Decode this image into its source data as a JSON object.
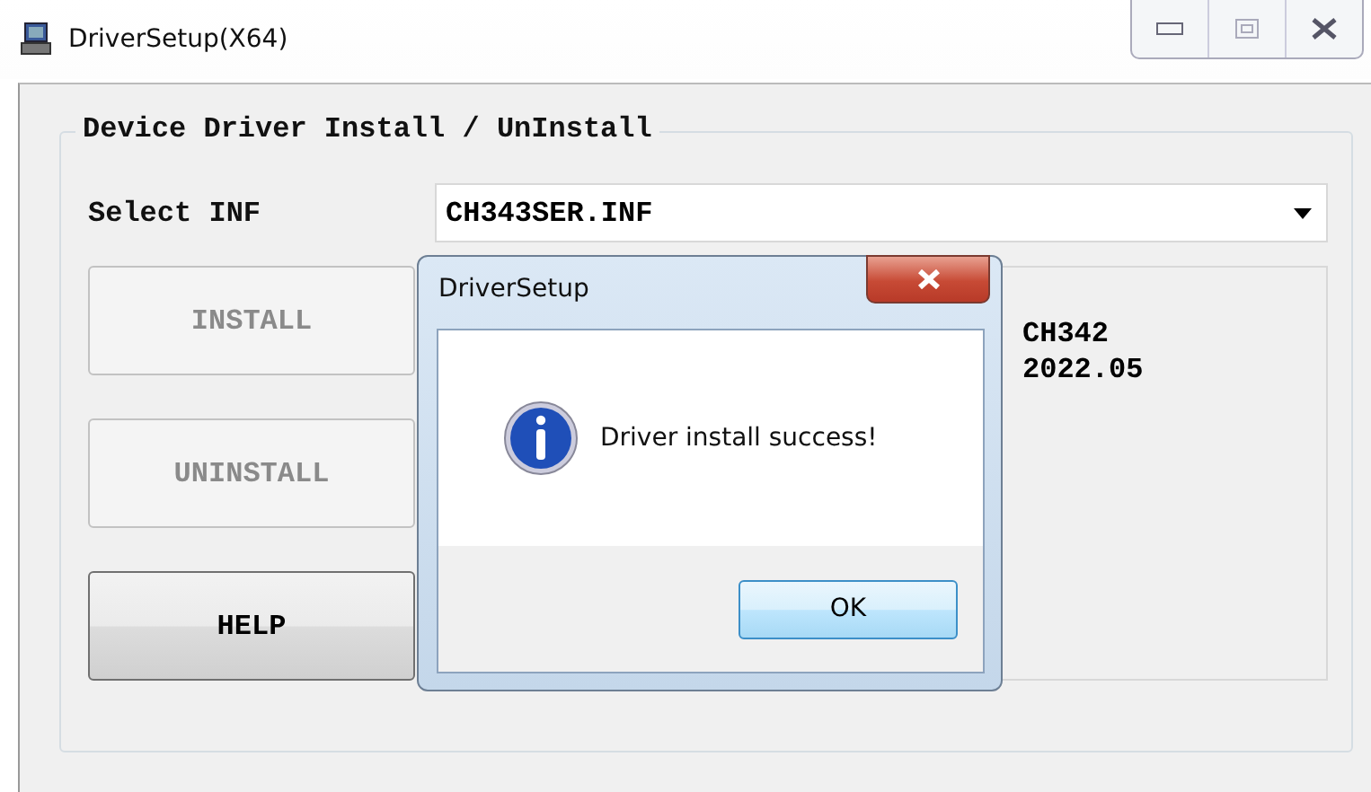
{
  "window": {
    "title": "DriverSetup(X64)"
  },
  "group": {
    "title": "Device Driver Install / UnInstall"
  },
  "select_inf": {
    "label": "Select INF",
    "value": "CH343SER.INF"
  },
  "buttons": [
    {
      "label": "INSTALL",
      "disabled": true
    },
    {
      "label": "UNINSTALL",
      "disabled": true
    },
    {
      "label": "HELP",
      "disabled": false
    }
  ],
  "info_lines": [
    "CH342",
    "2022.05"
  ],
  "dialog": {
    "title": "DriverSetup",
    "message": "Driver install success!",
    "button": "OK"
  }
}
